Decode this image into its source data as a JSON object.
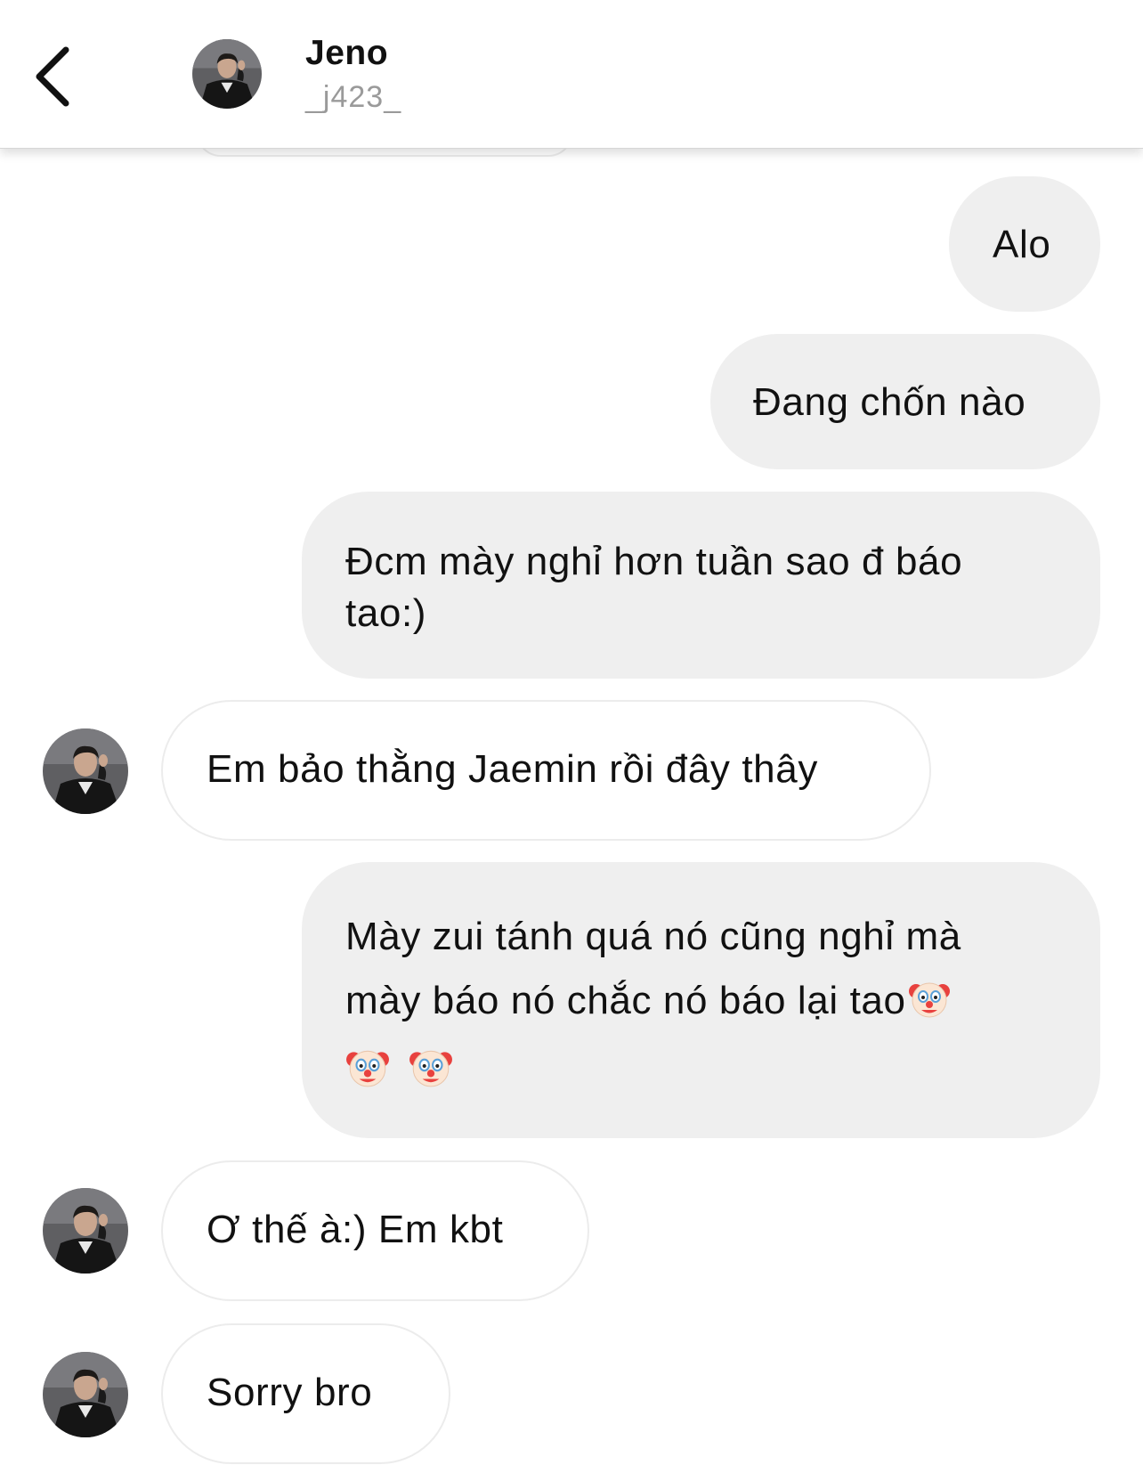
{
  "header": {
    "name": "Jeno",
    "username": "_j423_"
  },
  "messages": [
    {
      "side": "out",
      "text": "Alo"
    },
    {
      "side": "out",
      "text": "Đang chốn nào"
    },
    {
      "side": "out",
      "text_line1": "Đcm mày nghỉ hơn tuần sao đ báo",
      "text_line2": "tao:)"
    },
    {
      "side": "in",
      "text": "Em bảo thằng Jaemin rồi đây thây"
    },
    {
      "side": "out",
      "text_line1": "Mày zui tánh quá nó cũng nghỉ mà",
      "text_line2": "mày báo nó chắc nó báo lại tao",
      "emoji": "clown-face"
    },
    {
      "side": "in",
      "text": "Ơ thế à:) Em kbt"
    },
    {
      "side": "in",
      "text": "Sorry bro"
    }
  ],
  "colors": {
    "outgoing_bubble": "#efefef",
    "incoming_border": "#ececec",
    "username_gray": "#9a9a9a"
  }
}
